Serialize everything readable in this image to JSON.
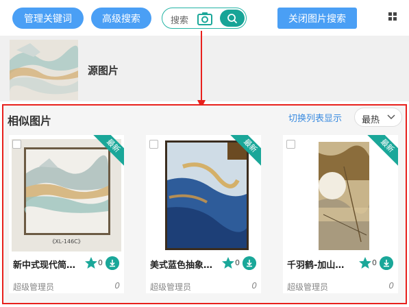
{
  "toolbar": {
    "manage_keywords": "管理关键词",
    "advanced_search": "高级搜索",
    "search_placeholder": "搜索",
    "close_image_search": "关闭图片搜索"
  },
  "source": {
    "label": "源图片"
  },
  "results": {
    "title": "相似图片",
    "switch_view": "切换列表显示",
    "sort": "最热",
    "new_badge": "最新",
    "items": [
      {
        "name": "新中式现代简…",
        "stars": "0",
        "user": "超级管理员",
        "views": "0",
        "caption": "《XL-146C》"
      },
      {
        "name": "美式蓝色抽象…",
        "stars": "0",
        "user": "超级管理员",
        "views": "0"
      },
      {
        "name": "千羽鹤-加山…",
        "stars": "0",
        "user": "超级管理员",
        "views": "0"
      }
    ]
  },
  "colors": {
    "accent": "#4a9ff5",
    "teal": "#1aa799",
    "highlight": "#e8201c"
  }
}
